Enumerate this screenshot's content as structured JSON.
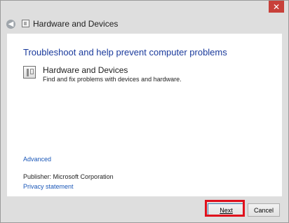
{
  "window": {
    "close_glyph": "✕",
    "title": "Hardware and Devices",
    "back_glyph": "◀"
  },
  "content": {
    "heading": "Troubleshoot and help prevent computer problems",
    "item": {
      "title": "Hardware and Devices",
      "description": "Find and fix problems with devices and hardware."
    },
    "advanced_link": "Advanced",
    "publisher_label": "Publisher:",
    "publisher_value": "Microsoft Corporation",
    "privacy_link": "Privacy statement"
  },
  "footer": {
    "next_label": "Next",
    "cancel_label": "Cancel"
  },
  "colors": {
    "accent_link": "#1a57b8",
    "heading": "#1a3a9c",
    "close": "#c8403a",
    "highlight": "#e0101c"
  }
}
